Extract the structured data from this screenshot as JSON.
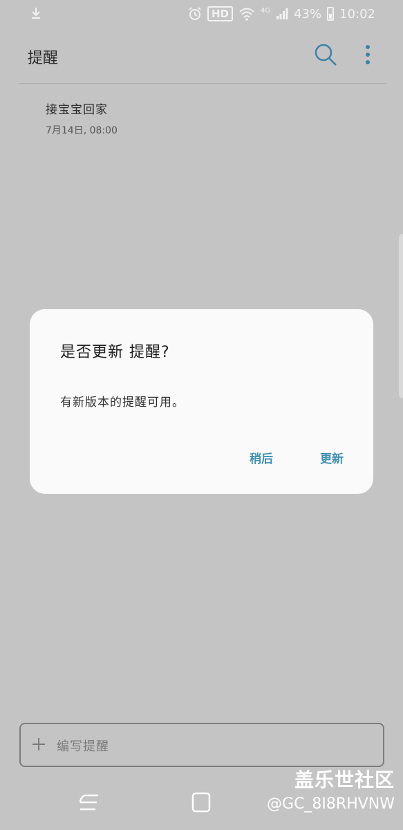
{
  "status_bar": {
    "hd": "HD",
    "network": "4G",
    "battery": "43%",
    "time": "10:02"
  },
  "header": {
    "title": "提醒"
  },
  "reminders": [
    {
      "title": "接宝宝回家",
      "datetime": "7月14日, 08:00"
    }
  ],
  "dialog": {
    "title": "是否更新 提醒?",
    "message": "有新版本的提醒可用。",
    "later_label": "稍后",
    "update_label": "更新"
  },
  "compose": {
    "placeholder": "编写提醒"
  },
  "watermark": {
    "brand": "盖乐世社区",
    "user": "@GC_8I8RHVNW"
  },
  "colors": {
    "background": "#c4c4c4",
    "dialog": "#fafafa",
    "accent": "#3f8fb0"
  }
}
